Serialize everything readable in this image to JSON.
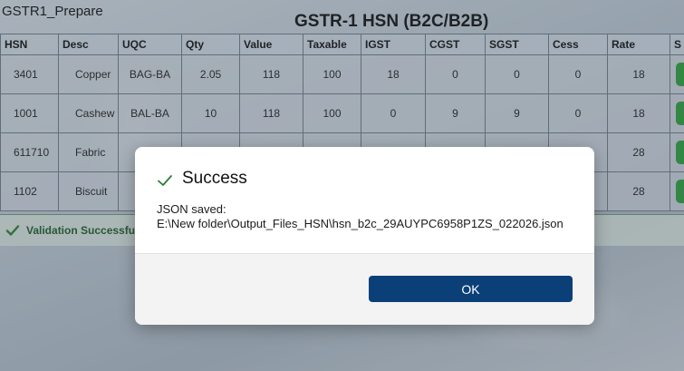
{
  "window": {
    "title": "GSTR1_Prepare"
  },
  "page": {
    "title": "GSTR-1 HSN (B2C/B2B)"
  },
  "table": {
    "columns": [
      "HSN",
      "Desc",
      "UQC",
      "Qty",
      "Value",
      "Taxable",
      "IGST",
      "CGST",
      "SGST",
      "Cess",
      "Rate",
      "S"
    ],
    "rows": [
      {
        "hsn": "3401",
        "desc": "Copper",
        "uqc": "BAG-BA",
        "qty": "2.05",
        "value": "118",
        "taxable": "100",
        "igst": "18",
        "cgst": "0",
        "sgst": "0",
        "cess": "0",
        "rate": "18"
      },
      {
        "hsn": "1001",
        "desc": "Cashew",
        "uqc": "BAL-BA",
        "qty": "10",
        "value": "118",
        "taxable": "100",
        "igst": "0",
        "cgst": "9",
        "sgst": "9",
        "cess": "0",
        "rate": "18"
      },
      {
        "hsn": "611710",
        "desc": "Fabric",
        "uqc": "",
        "qty": "",
        "value": "",
        "taxable": "",
        "igst": "",
        "cgst": "",
        "sgst": "",
        "cess": "",
        "rate": "28"
      },
      {
        "hsn": "1102",
        "desc": "Biscuit",
        "uqc": "",
        "qty": "",
        "value": "",
        "taxable": "",
        "igst": "",
        "cgst": "",
        "sgst": "",
        "cess": "",
        "rate": "28"
      }
    ]
  },
  "status": {
    "text": "Validation Successful",
    "color": "#2e7d32"
  },
  "dialog": {
    "title": "Success",
    "message_line1": "JSON saved:",
    "message_line2": "E:\\New folder\\Output_Files_HSN\\hsn_b2c_29AUYPC6958P1ZS_022026.json",
    "ok_label": "OK",
    "accent": "#0b3f78"
  }
}
